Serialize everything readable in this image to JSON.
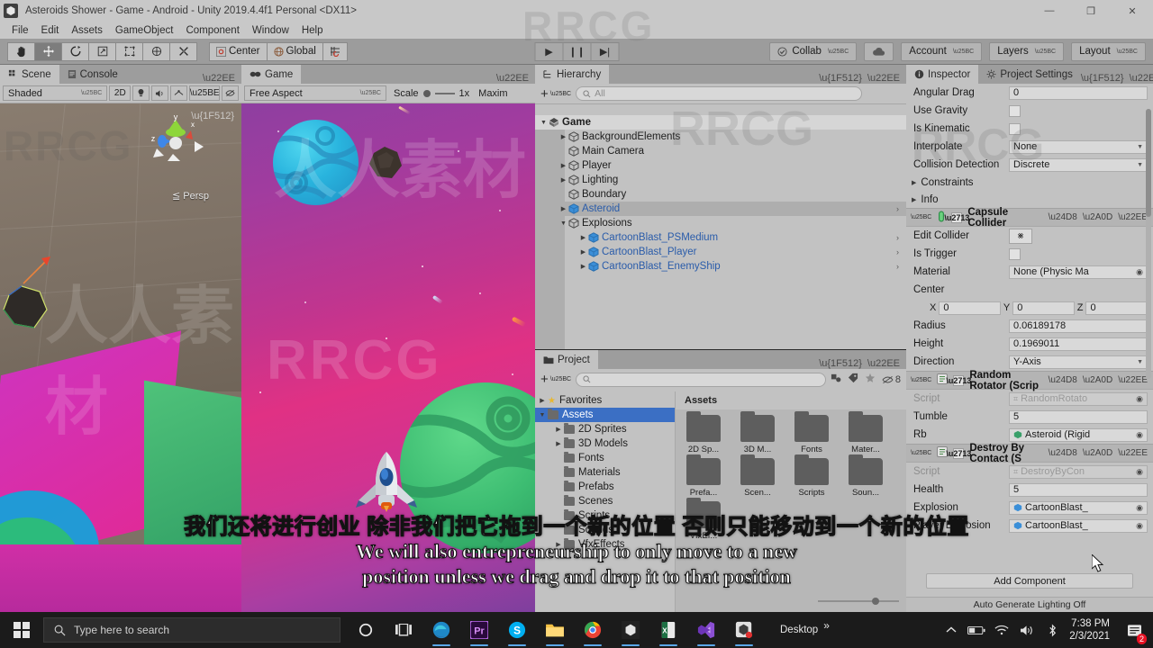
{
  "window": {
    "title": "Asteroids Shower - Game - Android - Unity 2019.4.4f1 Personal <DX11>",
    "minimize": "—",
    "maximize": "❐",
    "close": "✕"
  },
  "menu": [
    "File",
    "Edit",
    "Assets",
    "GameObject",
    "Component",
    "Window",
    "Help"
  ],
  "toolbar": {
    "tools": [
      {
        "name": "hand-tool",
        "glyph": "✋",
        "active": false
      },
      {
        "name": "move-tool",
        "glyph": "✥",
        "active": true
      },
      {
        "name": "rotate-tool",
        "glyph": "↻",
        "active": false
      },
      {
        "name": "scale-tool",
        "glyph": "⤢",
        "active": false
      },
      {
        "name": "rect-tool",
        "glyph": "⬚",
        "active": false
      },
      {
        "name": "transform-tool",
        "glyph": "⊕",
        "active": false
      },
      {
        "name": "custom-editor-tool",
        "glyph": "⚒",
        "active": false
      }
    ],
    "pivot": "Center",
    "handle": "Global",
    "grid_snap": "⌗",
    "play": "▶",
    "pause": "❙❙",
    "step": "▶|",
    "collab": "Collab",
    "cloud": "☁",
    "account": "Account",
    "layers": "Layers",
    "layout": "Layout"
  },
  "scene_panel": {
    "tabs": [
      {
        "label": "Scene",
        "icon": "grid-icon",
        "active": true
      },
      {
        "label": "Console",
        "icon": "console-icon",
        "active": false
      }
    ],
    "draw_mode": "Shaded",
    "mode_2d": "2D",
    "lighting_icon": "light-bulb-icon",
    "audio_icon": "speaker-icon",
    "fx_icon": "effects-icon",
    "persp_label": "≦ Persp",
    "gizmo_axes": [
      "x",
      "y",
      "z"
    ]
  },
  "game_panel": {
    "tabs": [
      {
        "label": "Game",
        "icon": "gamepad-icon",
        "active": true
      }
    ],
    "aspect": "Free Aspect",
    "scale_label": "Scale",
    "scale_value": "1x",
    "maximize": "Maxim"
  },
  "hierarchy": {
    "tabs": [
      {
        "label": "Hierarchy",
        "icon": "hierarchy-icon",
        "active": true
      }
    ],
    "lock_icon": "lock-icon",
    "menu_icon": "kebab-icon",
    "add_label": "+",
    "search_placeholder": "All",
    "items": [
      {
        "label": "Game",
        "depth": 0,
        "twirl": "▼",
        "root": true,
        "selected": false,
        "prefab": false,
        "arrow": false
      },
      {
        "label": "BackgroundElements",
        "depth": 1,
        "twirl": "▶",
        "root": false,
        "selected": false,
        "prefab": false,
        "arrow": false
      },
      {
        "label": "Main Camera",
        "depth": 1,
        "twirl": "",
        "root": false,
        "selected": false,
        "prefab": false,
        "arrow": false
      },
      {
        "label": "Player",
        "depth": 1,
        "twirl": "▶",
        "root": false,
        "selected": false,
        "prefab": false,
        "arrow": false
      },
      {
        "label": "Lighting",
        "depth": 1,
        "twirl": "▶",
        "root": false,
        "selected": false,
        "prefab": false,
        "arrow": false
      },
      {
        "label": "Boundary",
        "depth": 1,
        "twirl": "",
        "root": false,
        "selected": false,
        "prefab": false,
        "arrow": false
      },
      {
        "label": "Asteroid",
        "depth": 1,
        "twirl": "▶",
        "root": false,
        "selected": true,
        "prefab": true,
        "arrow": true
      },
      {
        "label": "Explosions",
        "depth": 1,
        "twirl": "▼",
        "root": false,
        "selected": false,
        "prefab": false,
        "arrow": false
      },
      {
        "label": "CartoonBlast_PSMedium",
        "depth": 2,
        "twirl": "▶",
        "root": false,
        "selected": false,
        "prefab": true,
        "arrow": true
      },
      {
        "label": "CartoonBlast_Player",
        "depth": 2,
        "twirl": "▶",
        "root": false,
        "selected": false,
        "prefab": true,
        "arrow": true
      },
      {
        "label": "CartoonBlast_EnemyShip",
        "depth": 2,
        "twirl": "▶",
        "root": false,
        "selected": false,
        "prefab": true,
        "arrow": true
      }
    ]
  },
  "project": {
    "tabs": [
      {
        "label": "Project",
        "icon": "folder-icon",
        "active": true
      }
    ],
    "lock_icon": "lock-icon",
    "menu_icon": "kebab-icon",
    "add_label": "+",
    "search_placeholder": "",
    "hidden_count": "8",
    "assets_header": "Assets",
    "tree": [
      {
        "label": "Favorites",
        "depth": 0,
        "twirl": "▶",
        "star": true,
        "selected": false
      },
      {
        "label": "Assets",
        "depth": 0,
        "twirl": "▼",
        "star": false,
        "selected": true
      },
      {
        "label": "2D Sprites",
        "depth": 1,
        "twirl": "▶",
        "star": false,
        "selected": false
      },
      {
        "label": "3D Models",
        "depth": 1,
        "twirl": "▶",
        "star": false,
        "selected": false
      },
      {
        "label": "Fonts",
        "depth": 1,
        "twirl": "",
        "star": false,
        "selected": false
      },
      {
        "label": "Materials",
        "depth": 1,
        "twirl": "",
        "star": false,
        "selected": false
      },
      {
        "label": "Prefabs",
        "depth": 1,
        "twirl": "",
        "star": false,
        "selected": false
      },
      {
        "label": "Scenes",
        "depth": 1,
        "twirl": "",
        "star": false,
        "selected": false
      },
      {
        "label": "Scripts",
        "depth": 1,
        "twirl": "",
        "star": false,
        "selected": false
      },
      {
        "label": "Sounds",
        "depth": 1,
        "twirl": "",
        "star": false,
        "selected": false
      },
      {
        "label": "VfxEffects",
        "depth": 1,
        "twirl": "▶",
        "star": false,
        "selected": false
      }
    ],
    "grid": [
      "2D Sp...",
      "3D M...",
      "Fonts",
      "Mater...",
      "Prefa...",
      "Scen...",
      "Scripts",
      "Soun...",
      "VfxEf..."
    ]
  },
  "inspector": {
    "tabs": [
      {
        "label": "Inspector",
        "icon": "info-icon",
        "active": true
      },
      {
        "label": "Project Settings",
        "icon": "settings-icon",
        "active": false
      }
    ],
    "lock_icon": "lock-icon",
    "menu_icon": "kebab-icon",
    "rigidbody_rows": [
      {
        "kind": "field",
        "label": "Angular Drag",
        "value": "0"
      },
      {
        "kind": "check",
        "label": "Use Gravity",
        "checked": false
      },
      {
        "kind": "check",
        "label": "Is Kinematic",
        "checked": false
      },
      {
        "kind": "dropdown",
        "label": "Interpolate",
        "value": "None"
      },
      {
        "kind": "dropdown",
        "label": "Collision Detection",
        "value": "Discrete"
      },
      {
        "kind": "foldout",
        "label": "Constraints"
      },
      {
        "kind": "foldout",
        "label": "Info"
      }
    ],
    "capsule_collider": {
      "title": "Capsule Collider",
      "enabled": true,
      "icon": "capsule-collider-icon",
      "rows": [
        {
          "kind": "button",
          "label": "Edit Collider",
          "value": "⨳"
        },
        {
          "kind": "check",
          "label": "Is Trigger",
          "checked": false
        },
        {
          "kind": "object",
          "label": "Material",
          "value": "None (Physic Ma"
        },
        {
          "kind": "label",
          "label": "Center"
        },
        {
          "kind": "vec3",
          "label": "",
          "x": "0",
          "y": "0",
          "z": "0"
        },
        {
          "kind": "field",
          "label": "Radius",
          "value": "0.06189178"
        },
        {
          "kind": "field",
          "label": "Height",
          "value": "0.1969011"
        },
        {
          "kind": "dropdown",
          "label": "Direction",
          "value": "Y-Axis"
        }
      ]
    },
    "random_rotator": {
      "title": "Random Rotator (Scrip",
      "enabled": true,
      "icon": "script-icon",
      "rows": [
        {
          "kind": "object",
          "label": "Script",
          "value": "RandomRotato",
          "disabled": true
        },
        {
          "kind": "field",
          "label": "Tumble",
          "value": "5"
        },
        {
          "kind": "object",
          "label": "Rb",
          "value": "Asteroid (Rigid",
          "disabled": false
        }
      ]
    },
    "destroy_by_contact": {
      "title": "Destroy By Contact (S",
      "enabled": true,
      "icon": "script-icon",
      "rows": [
        {
          "kind": "object",
          "label": "Script",
          "value": "DestroyByCon",
          "disabled": true
        },
        {
          "kind": "field",
          "label": "Health",
          "value": "5"
        },
        {
          "kind": "object",
          "label": "Explosion",
          "value": "CartoonBlast_",
          "disabled": false
        },
        {
          "kind": "object",
          "label": "Player Explosion",
          "value": "CartoonBlast_",
          "disabled": false
        }
      ]
    },
    "add_component": "Add Component",
    "auto_generate_lighting": "Auto Generate Lighting Off",
    "help_icon": "help-icon",
    "preset_icon": "preset-icon",
    "kebab_icon": "kebab-icon"
  },
  "subtitles": {
    "chinese": "我们还将进行创业 除非我们把它拖到一个新的位置 否则只能移动到一个新的位置",
    "english_line1": "We will also entrepreneurship to only move to a new",
    "english_line2": "position unless we drag and drop it to that position"
  },
  "watermarks": {
    "rrcg": "RRCG",
    "chinese": "人人素材"
  },
  "taskbar": {
    "start_icon": "windows-logo-icon",
    "search_placeholder": "Type here to search",
    "search_icon": "search-icon",
    "cortana_icon": "cortana-icon",
    "taskview_icon": "task-view-icon",
    "apps": [
      {
        "name": "edge-icon",
        "running": true
      },
      {
        "name": "premiere-icon",
        "running": true
      },
      {
        "name": "skype-icon",
        "running": true
      },
      {
        "name": "explorer-icon",
        "running": true
      },
      {
        "name": "chrome-icon",
        "running": true
      },
      {
        "name": "unity-icon",
        "running": true
      },
      {
        "name": "excel-icon",
        "running": true
      },
      {
        "name": "visual-studio-icon",
        "running": true
      },
      {
        "name": "unity-hub-icon",
        "running": true
      }
    ],
    "desktop_label": "Desktop",
    "overflow": "»",
    "chevron_icon": "chevron-up-icon",
    "battery_icon": "battery-icon",
    "wifi_icon": "wifi-icon",
    "volume_icon": "volume-icon",
    "bluetooth_icon": "bluetooth-icon",
    "time": "7:38 PM",
    "date": "2/3/2021",
    "notification_count": "2"
  }
}
